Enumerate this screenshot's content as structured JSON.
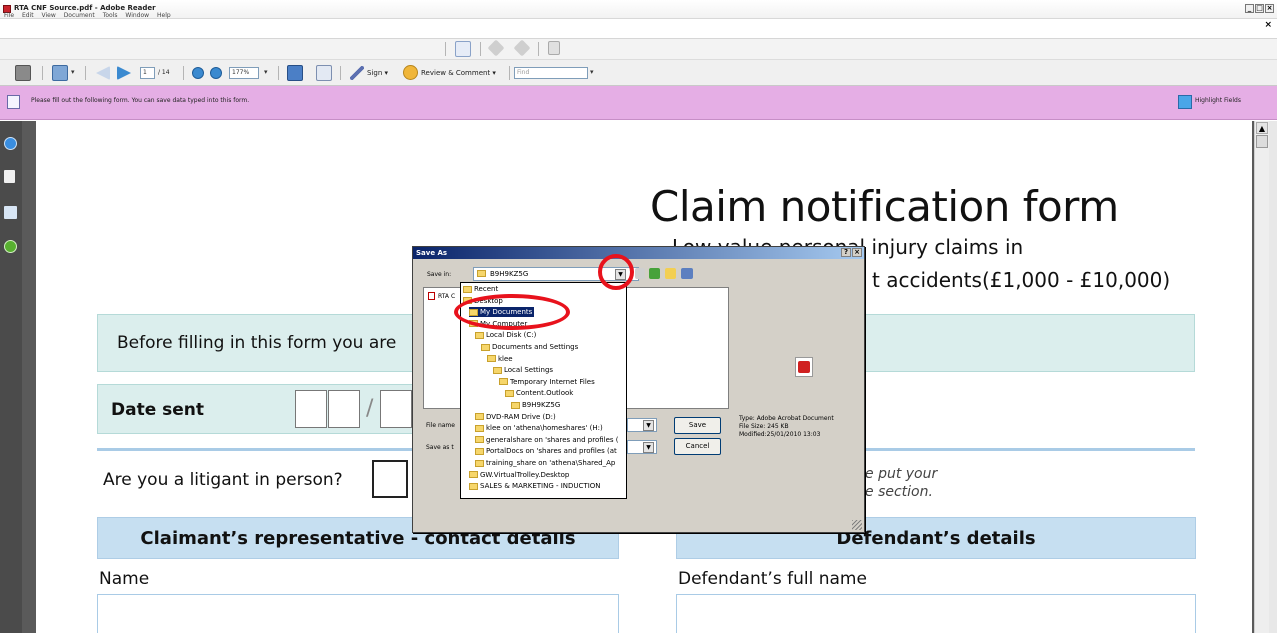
{
  "window": {
    "title": "RTA CNF Source.pdf - Adobe Reader",
    "menu": [
      "File",
      "Edit",
      "View",
      "Document",
      "Tools",
      "Window",
      "Help"
    ],
    "controls": [
      "_",
      "□",
      "×"
    ],
    "doc_close": "×"
  },
  "toolbar": {
    "page_current": "1",
    "page_total": "/ 14",
    "zoom": "177%",
    "sign_label": "Sign ▾",
    "review_label": "Review & Comment ▾",
    "find_placeholder": "Find",
    "arrow": "▾"
  },
  "form_message": {
    "text": "Please fill out the following form. You can save data typed into this form.",
    "highlight_label": "Highlight Fields"
  },
  "document": {
    "title": "Claim notification form",
    "subtitle_1": "Low value personal injury claims in",
    "subtitle_2": "t accidents(£1,000 - £10,000)",
    "before_filling": "Before filling in this form you are",
    "date_sent": "Date sent",
    "date_sep": "/",
    "litigant_question": "Are you a litigant in person?",
    "note_line1": "e put your",
    "note_line2": "e section.",
    "claimant_rep_heading": "Claimant’s representative - contact details",
    "defendant_heading": "Defendant’s details",
    "name_label": "Name",
    "defendant_name_label": "Defendant’s full name"
  },
  "dialog": {
    "title": "Save As",
    "title_buttons": [
      "?",
      "×"
    ],
    "save_in_label": "Save in:",
    "save_in_value": "B9H9KZ5G",
    "file_list_item": "RTA C",
    "file_name_label": "File name",
    "save_as_type_label": "Save as t",
    "save_button": "Save",
    "cancel_button": "Cancel",
    "file_info": {
      "type": "Type: Adobe Acrobat Document",
      "size": "File Size: 245 KB",
      "modified": "Modified:25/01/2010 13:03"
    },
    "locations": [
      {
        "label": "Recent",
        "indent": 0,
        "selected": false
      },
      {
        "label": "Desktop",
        "indent": 0,
        "selected": false
      },
      {
        "label": "My Documents",
        "indent": 1,
        "selected": true
      },
      {
        "label": "My Computer",
        "indent": 1,
        "selected": false
      },
      {
        "label": "Local Disk (C:)",
        "indent": 2,
        "selected": false
      },
      {
        "label": "Documents and Settings",
        "indent": 3,
        "selected": false
      },
      {
        "label": "klee",
        "indent": 4,
        "selected": false
      },
      {
        "label": "Local Settings",
        "indent": 5,
        "selected": false
      },
      {
        "label": "Temporary Internet Files",
        "indent": 6,
        "selected": false
      },
      {
        "label": "Content.Outlook",
        "indent": 7,
        "selected": false
      },
      {
        "label": "B9H9KZ5G",
        "indent": 8,
        "selected": false
      },
      {
        "label": "DVD-RAM Drive (D:)",
        "indent": 2,
        "selected": false
      },
      {
        "label": "klee on 'athena\\homeshares' (H:)",
        "indent": 2,
        "selected": false
      },
      {
        "label": "generalshare on 'shares and profiles (",
        "indent": 2,
        "selected": false
      },
      {
        "label": "PortalDocs on 'shares and profiles (at",
        "indent": 2,
        "selected": false
      },
      {
        "label": "training_share on 'athena\\Shared_Ap",
        "indent": 2,
        "selected": false
      },
      {
        "label": "GW.VirtualTrolley.Desktop",
        "indent": 1,
        "selected": false
      },
      {
        "label": "SALES & MARKETING - INDUCTION",
        "indent": 1,
        "selected": false
      }
    ]
  },
  "colors": {
    "form_bar": "#e5aee5",
    "annotation_red": "#e8121c",
    "selection_blue": "#0a246a",
    "band_teal": "#dbeeed",
    "section_blue": "#c6dff1"
  }
}
